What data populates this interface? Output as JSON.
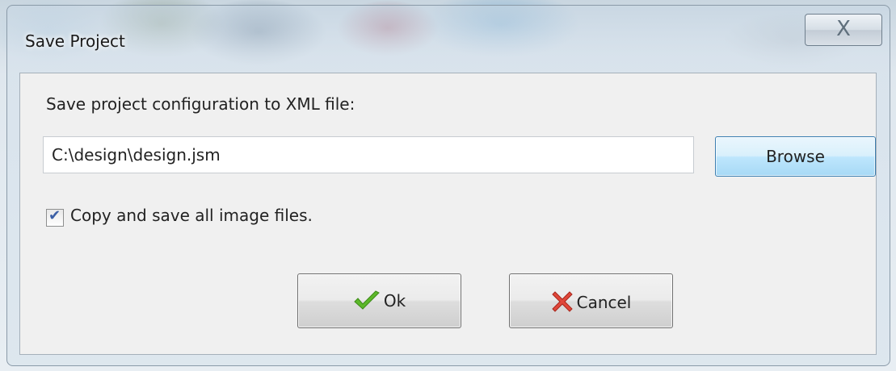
{
  "window": {
    "title": "Save Project",
    "close_glyph": "X"
  },
  "dialog": {
    "prompt": "Save project configuration to XML file:",
    "path_value": "C:\\design\\design.jsm",
    "browse_label": "Browse",
    "checkbox": {
      "label": "Copy and save all image files.",
      "checked": true
    },
    "ok_label": "Ok",
    "cancel_label": "Cancel"
  },
  "icons": {
    "ok": "checkmark-icon",
    "cancel": "red-x-icon"
  },
  "colors": {
    "browse_border": "#3c7fb1",
    "ok_icon": "#5cb82a",
    "cancel_icon": "#e0473a"
  }
}
